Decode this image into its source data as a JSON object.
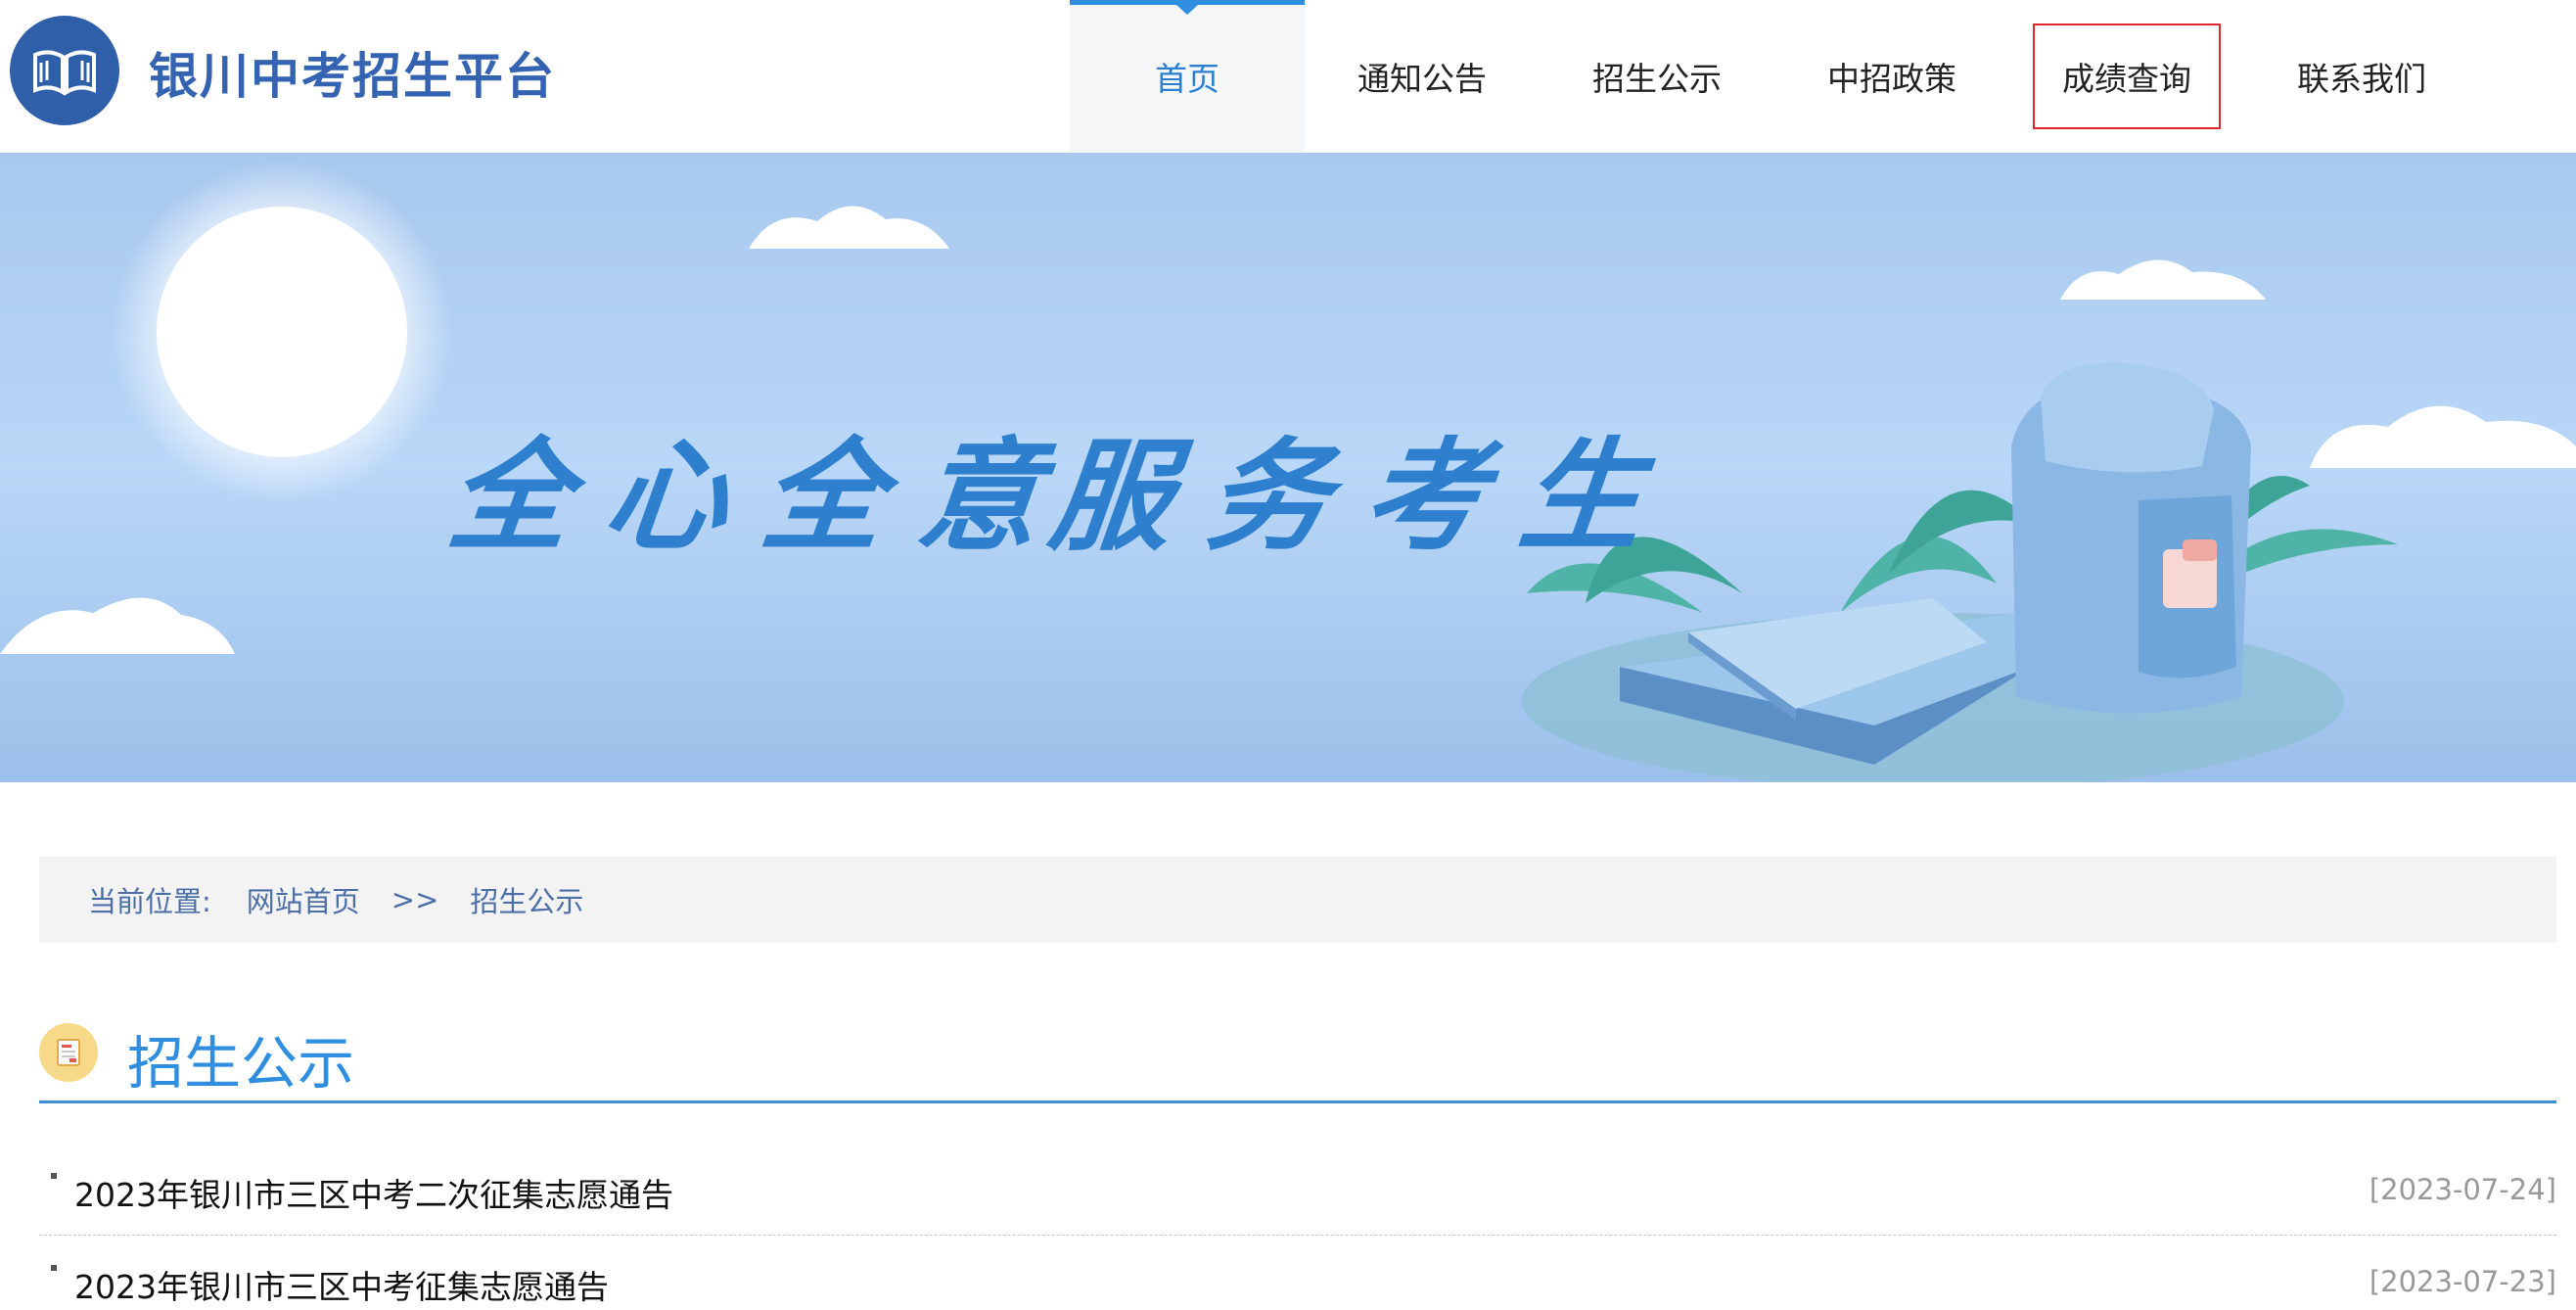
{
  "header": {
    "site_title": "银川中考招生平台",
    "logo_icon": "open-book-icon",
    "nav": [
      {
        "label": "首页",
        "active": true
      },
      {
        "label": "通知公告"
      },
      {
        "label": "招生公示"
      },
      {
        "label": "中招政策"
      },
      {
        "label": "成绩查询",
        "highlighted": true
      },
      {
        "label": "联系我们"
      }
    ]
  },
  "banner": {
    "slogan_left": "全心全意",
    "slogan_right": "服务考生"
  },
  "breadcrumb": {
    "label": "当前位置:",
    "home": "网站首页",
    "separator": ">>",
    "current": "招生公示"
  },
  "section": {
    "title": "招生公示",
    "icon": "notice-document-icon"
  },
  "news": [
    {
      "title": "2023年银川市三区中考二次征集志愿通告",
      "date": "[2023-07-24]"
    },
    {
      "title": "2023年银川市三区中考征集志愿通告",
      "date": "[2023-07-23]"
    }
  ],
  "colors": {
    "brand": "#3464b1",
    "accent": "#2f8ee0",
    "highlight_border": "#e0262c"
  }
}
